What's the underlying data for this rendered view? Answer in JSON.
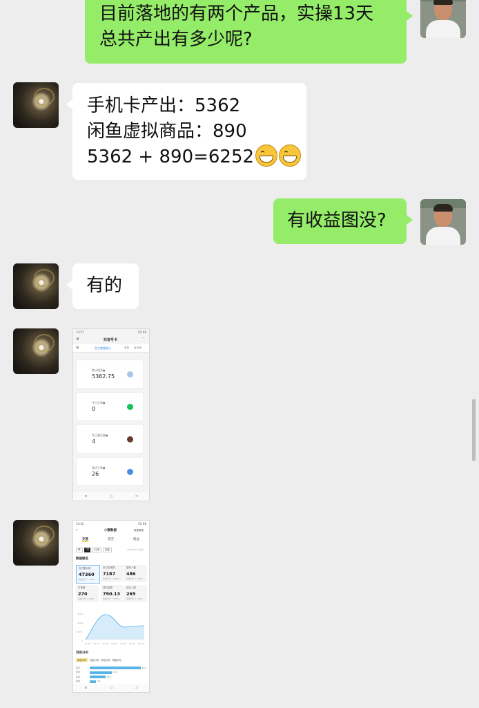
{
  "messages": [
    {
      "lines": [
        "目前落地的有两个产品，实操13天",
        "总共产出有多少呢?"
      ]
    },
    {
      "lines": [
        "手机卡产出：5362",
        "闲鱼虚拟商品：890",
        "5362 + 890=6252"
      ]
    },
    {
      "lines": [
        "有收益图没?"
      ]
    },
    {
      "lines": [
        "有的"
      ]
    }
  ],
  "shot1": {
    "time": "13:57",
    "status": "5G 69",
    "title": "抖音号卡",
    "tab_active": "官方数据统计",
    "filter_a": "本月",
    "filter_b": "近30天",
    "cards": [
      {
        "label": "累计佣金●",
        "value": "5362.75",
        "color": "#a9c6e8"
      },
      {
        "label": "今日订单●",
        "value": "0",
        "color": "#19c15a"
      },
      {
        "label": "今日激活量●",
        "value": "4",
        "color": "#6a3b2a"
      },
      {
        "label": "激活订单●",
        "value": "26",
        "color": "#4a8fe0"
      }
    ],
    "nav": [
      "≡",
      "○",
      "⊃"
    ]
  },
  "shot2": {
    "time": "14:02",
    "status": "5G 68",
    "title": "小额数据",
    "right_link": "数据周报",
    "tabs": [
      "交易",
      "资交",
      "粉丝"
    ],
    "ranges": [
      "昨",
      "7天",
      "30天",
      "自定"
    ],
    "date": "2024-04-01 至今",
    "section": "数据概览",
    "cells": [
      {
        "k": "支付累计数",
        "v": "47360",
        "c": "比前7天 ↑ 100%"
      },
      {
        "k": "支付买家数",
        "v": "7187",
        "c": "比前7天 ↑ 100%"
      },
      {
        "k": "复购人数",
        "v": "486",
        "c": "比前7天 ↑ 100%"
      },
      {
        "k": "订单数",
        "v": "270",
        "c": "比前7天 ↑ 100%"
      },
      {
        "k": "成交金额",
        "v": "790.13",
        "c": "比前7天 ↑ 100%"
      },
      {
        "k": "成交人数",
        "v": "265",
        "c": "比前7天 ↑ 100%"
      }
    ],
    "y_ticks": [
      "15000",
      "10000",
      "5000",
      "0"
    ],
    "x_ticks": [
      "04-26",
      "04-27",
      "04-28",
      "04-29",
      "04-30",
      "05-01",
      "05-02"
    ],
    "dist_title": "浏览分布",
    "dist_tabs": [
      "渠道分布",
      "地区分布",
      "时段分布",
      "终端分布"
    ],
    "bars": [
      {
        "k": "首页",
        "pct": 0.49,
        "label": "49%"
      },
      {
        "k": "搜索",
        "pct": 0.21,
        "label": "21%"
      },
      {
        "k": "商品",
        "pct": 0.15,
        "label": "15%"
      },
      {
        "k": "其他",
        "pct": 0.06,
        "label": "6%"
      }
    ],
    "nav": [
      "≡",
      "○",
      "⊃"
    ]
  }
}
